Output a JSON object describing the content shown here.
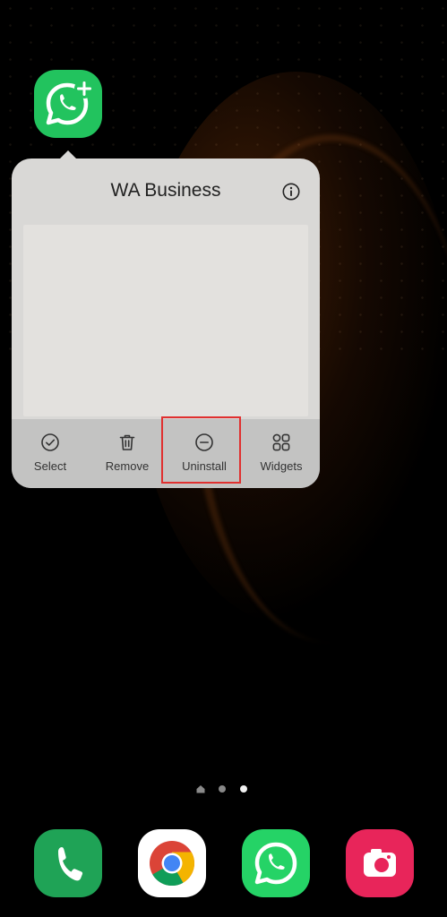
{
  "home_screen": {
    "shortcut_app": {
      "name": "WA Business",
      "icon": "whatsapp-business-icon"
    }
  },
  "popup": {
    "title": "WA Business",
    "info_icon": "info-icon",
    "actions": [
      {
        "label": "Select",
        "icon": "check-circle-icon"
      },
      {
        "label": "Remove",
        "icon": "trash-icon"
      },
      {
        "label": "Uninstall",
        "icon": "minus-circle-icon",
        "highlighted": true
      },
      {
        "label": "Widgets",
        "icon": "widgets-grid-icon"
      }
    ],
    "highlight_color": "#e0302f"
  },
  "page_indicator": {
    "pages": 3,
    "current": 3
  },
  "dock": [
    {
      "app": "Phone",
      "icon": "phone-icon",
      "color": "#1fa356"
    },
    {
      "app": "Chrome",
      "icon": "chrome-icon",
      "color": "#ffffff"
    },
    {
      "app": "WhatsApp",
      "icon": "whatsapp-icon",
      "color": "#25d366"
    },
    {
      "app": "Camera",
      "icon": "camera-icon",
      "color": "#e8255a"
    }
  ]
}
